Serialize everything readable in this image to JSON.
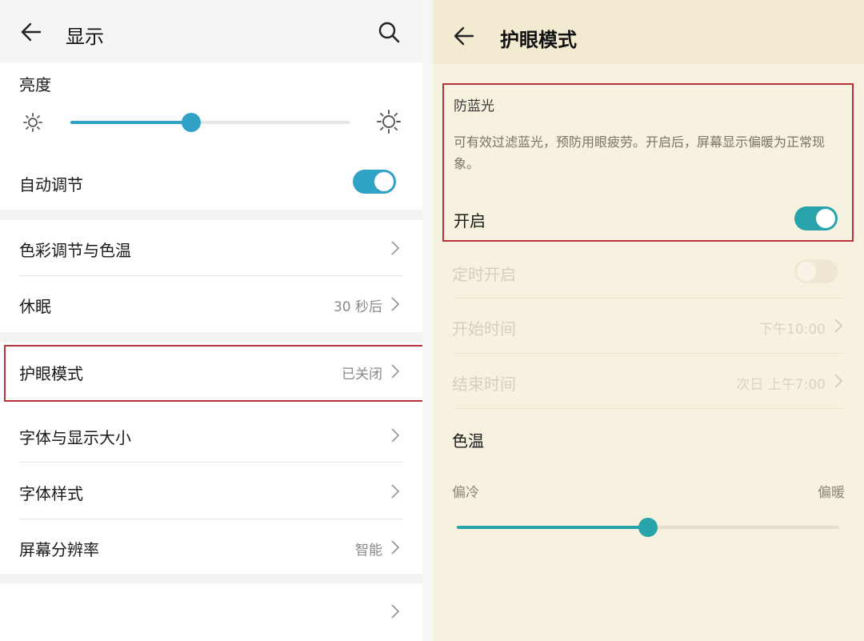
{
  "left": {
    "header": {
      "title": "显示"
    },
    "brightness": {
      "title": "亮度",
      "level_percent": 43
    },
    "auto_adjust": {
      "label": "自动调节",
      "enabled": true
    },
    "items": [
      {
        "label": "色彩调节与色温",
        "value": ""
      },
      {
        "label": "休眠",
        "value": "30 秒后"
      },
      {
        "label": "护眼模式",
        "value": "已关闭"
      },
      {
        "label": "字体与显示大小",
        "value": ""
      },
      {
        "label": "字体样式",
        "value": ""
      },
      {
        "label": "屏幕分辨率",
        "value": "智能"
      }
    ]
  },
  "right": {
    "header": {
      "title": "护眼模式"
    },
    "blue_light": {
      "title": "防蓝光",
      "description": "可有效过滤蓝光，预防用眼疲劳。开启后，屏幕显示偏暖为正常现象。",
      "toggle_label": "开启",
      "enabled": true
    },
    "schedule": {
      "label": "定时开启",
      "enabled": false,
      "start_label": "开始时间",
      "start_value": "下午10:00",
      "end_label": "结束时间",
      "end_value": "次日 上午7:00"
    },
    "color_temp": {
      "title": "色温",
      "cool_label": "偏冷",
      "warm_label": "偏暖",
      "level_percent": 50
    }
  },
  "colors": {
    "accent_blue": "#2fa2c6",
    "accent_teal": "#27a3a9",
    "highlight_red": "#b8323a",
    "warm_bg": "#f7f1df"
  }
}
